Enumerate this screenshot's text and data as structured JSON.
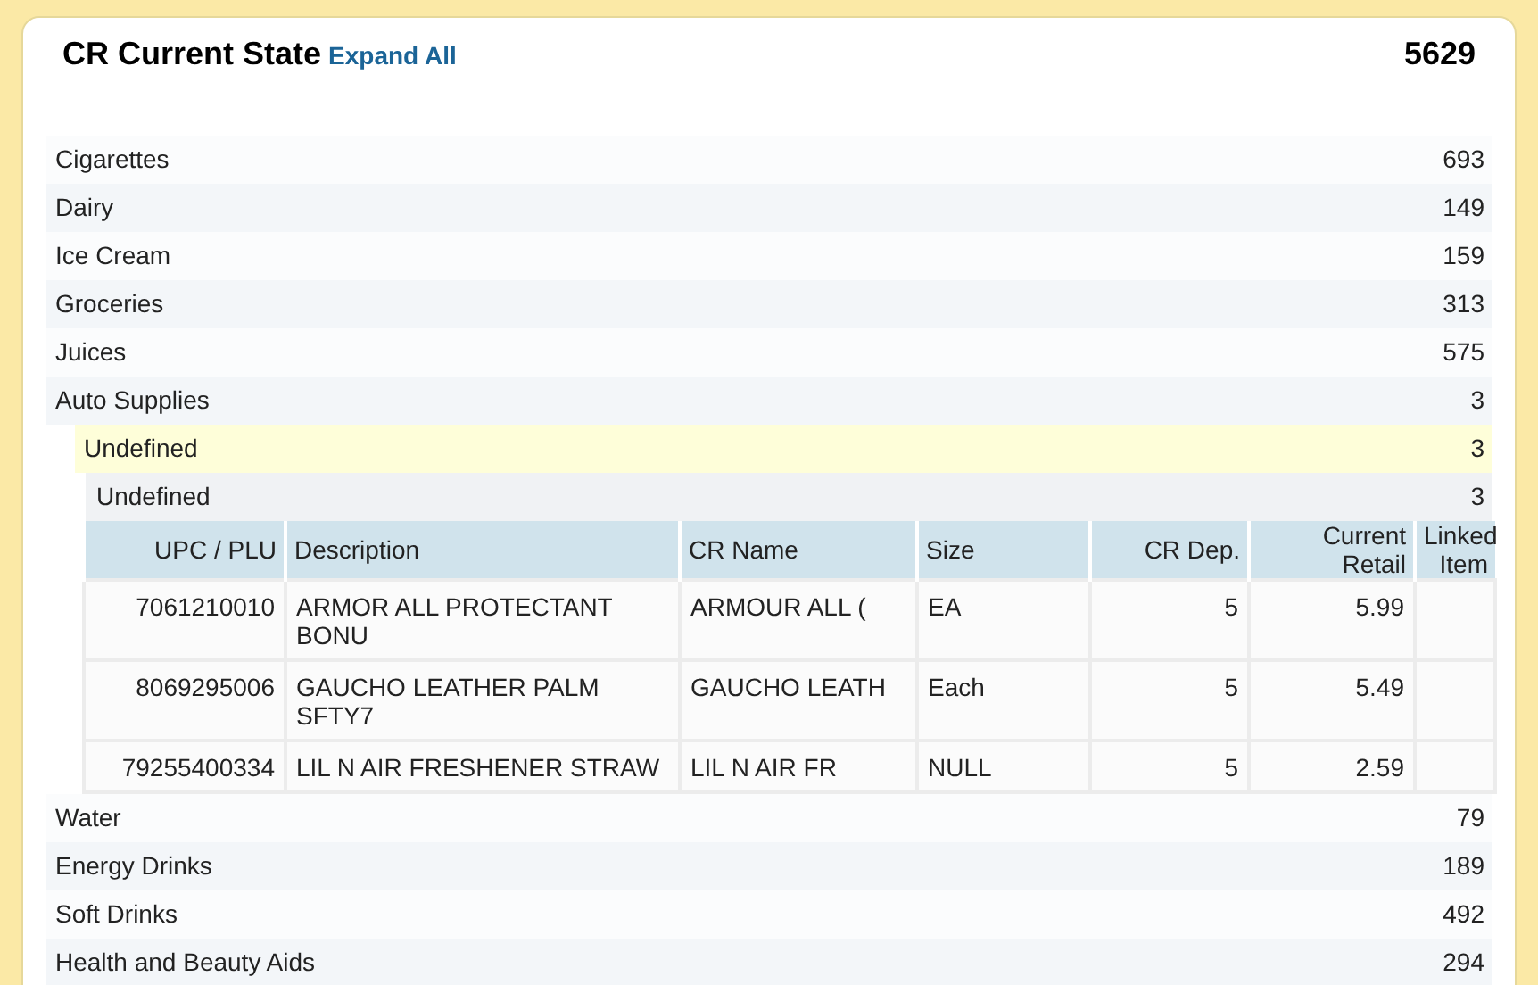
{
  "header": {
    "title": "CR Current State",
    "expand_all": "Expand All",
    "total": "5629"
  },
  "categories": [
    {
      "name": "Cigarettes",
      "count": "693"
    },
    {
      "name": "Dairy",
      "count": "149"
    },
    {
      "name": "Ice Cream",
      "count": "159"
    },
    {
      "name": "Groceries",
      "count": "313"
    },
    {
      "name": "Juices",
      "count": "575"
    },
    {
      "name": "Auto Supplies",
      "count": "3",
      "children": [
        {
          "name": "Undefined",
          "count": "3",
          "highlighted": true,
          "children": [
            {
              "name": "Undefined",
              "count": "3",
              "table": {
                "columns": [
                  "UPC / PLU",
                  "Description",
                  "CR Name",
                  "Size",
                  "CR Dep.",
                  "Current Retail",
                  "Linked Item"
                ],
                "rows": [
                  [
                    "7061210010",
                    "ARMOR ALL PROTECTANT BONU",
                    "ARMOUR ALL (",
                    "EA",
                    "5",
                    "5.99",
                    ""
                  ],
                  [
                    "8069295006",
                    "GAUCHO LEATHER PALM SFTY7",
                    "GAUCHO LEATH",
                    "Each",
                    "5",
                    "5.49",
                    ""
                  ],
                  [
                    "79255400334",
                    "LIL N AIR FRESHENER STRAW",
                    "LIL N AIR FR",
                    "NULL",
                    "5",
                    "2.59",
                    ""
                  ]
                ]
              }
            }
          ]
        }
      ]
    },
    {
      "name": "Water",
      "count": "79"
    },
    {
      "name": "Energy Drinks",
      "count": "189"
    },
    {
      "name": "Soft Drinks",
      "count": "492"
    },
    {
      "name": "Health and Beauty Aids",
      "count": "294"
    }
  ]
}
